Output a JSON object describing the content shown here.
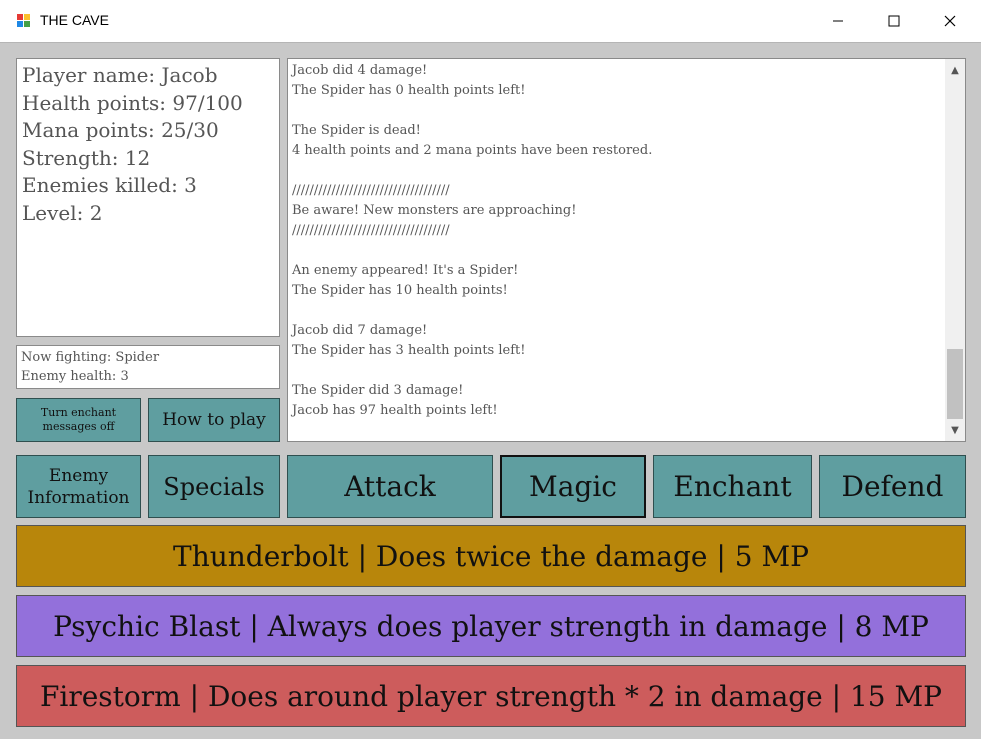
{
  "window": {
    "title": "THE CAVE"
  },
  "stats": {
    "player_name": "Player name: Jacob",
    "health": "Health points: 97/100",
    "mana": "Mana points: 25/30",
    "strength": "Strength: 12",
    "enemies_killed": "Enemies killed: 3",
    "level": "Level: 2"
  },
  "fight": {
    "now_fighting": "Now fighting: Spider",
    "enemy_health": "Enemy health: 3"
  },
  "log": [
    "Jacob did 4 damage!",
    "The Spider has 0 health points left!",
    "",
    "The Spider is dead!",
    "4 health points and 2 mana points have been restored.",
    "",
    "////////////////////////////////////",
    "Be aware! New monsters are approaching!",
    "////////////////////////////////////",
    "",
    "An enemy appeared! It's a Spider!",
    "The Spider has 10 health points!",
    "",
    "Jacob did 7 damage!",
    "The Spider has 3 health points left!",
    "",
    "The Spider did 3 damage!",
    "Jacob has 97 health points left!"
  ],
  "buttons": {
    "turn_enchant_line1": "Turn enchant",
    "turn_enchant_line2": "messages off",
    "how_to_play": "How to play",
    "enemy_info_line1": "Enemy",
    "enemy_info_line2": "Information",
    "specials": "Specials",
    "attack": "Attack",
    "magic": "Magic",
    "enchant": "Enchant",
    "defend": "Defend"
  },
  "spells": [
    {
      "label": "Thunderbolt | Does twice the damage | 5 MP",
      "color": "#b8860b"
    },
    {
      "label": "Psychic Blast | Always does player strength in damage | 8 MP",
      "color": "#9370db"
    },
    {
      "label": "Firestorm | Does around player strength * 2 in damage | 15 MP",
      "color": "#cd5c5c"
    }
  ],
  "colors": {
    "button": "#5f9ea0",
    "background": "#c8c8c8"
  }
}
